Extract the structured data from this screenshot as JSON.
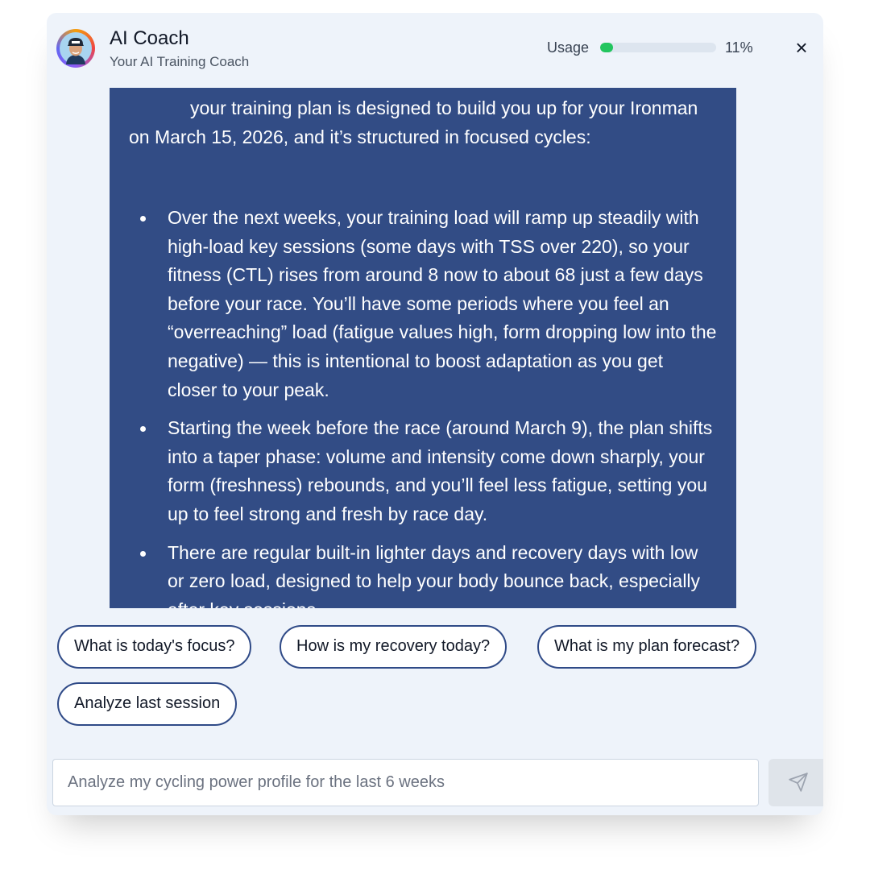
{
  "header": {
    "title": "AI Coach",
    "subtitle": "Your AI Training Coach",
    "usage_label": "Usage",
    "usage_percent": 11,
    "usage_text": "11%",
    "close_label": "×"
  },
  "message": {
    "intro": "your training plan is designed to build you up for your Ironman on March 15, 2026, and it’s structured in focused cycles:",
    "bullets": [
      "Over the next weeks, your training load will ramp up steadily with high-load key sessions (some days with TSS over 220), so your fitness (CTL) rises from around 8 now to about 68 just a few days before your race. You’ll have some periods where you feel an “overreaching” load (fatigue values high, form dropping low into the negative) — this is intentional to boost adaptation as you get closer to your peak.",
      "Starting the week before the race (around March 9), the plan shifts into a taper phase: volume and intensity come down sharply, your form (freshness) rebounds, and you’ll feel less fatigue, setting you up to feel strong and fresh by race day.",
      "There are regular built-in lighter days and recovery days with low or zero load, designed to help your body bounce back, especially after key sessions."
    ]
  },
  "suggestions": [
    "What is today's focus?",
    "How is my recovery today?",
    "What is my plan forecast?",
    "Analyze last session"
  ],
  "input": {
    "placeholder": "Analyze my cycling power profile for the last 6 weeks"
  },
  "colors": {
    "message_bg": "#324c85",
    "chip_border": "#2f4a87",
    "usage_fill": "#22c55e",
    "panel_bg": "#eef3fa"
  },
  "icons": {
    "avatar": "coach-avatar",
    "close": "close-icon",
    "send": "send-icon"
  }
}
